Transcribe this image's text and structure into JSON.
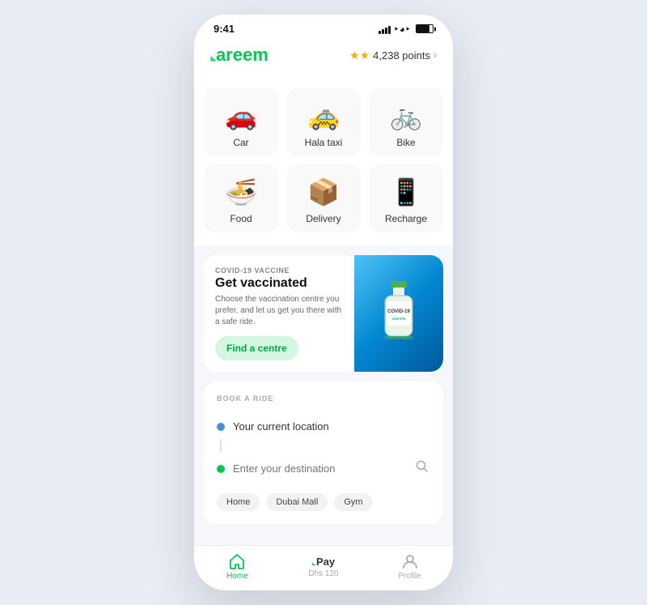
{
  "statusBar": {
    "time": "9:41"
  },
  "header": {
    "logo": "Careem",
    "points": "4,238 points"
  },
  "services": [
    {
      "id": "car",
      "emoji": "🚗",
      "label": "Car"
    },
    {
      "id": "hala-taxi",
      "emoji": "🚕",
      "label": "Hala taxi"
    },
    {
      "id": "bike",
      "emoji": "🚲",
      "label": "Bike"
    },
    {
      "id": "food",
      "emoji": "🍜",
      "label": "Food"
    },
    {
      "id": "delivery",
      "emoji": "📦",
      "label": "Delivery"
    },
    {
      "id": "recharge",
      "emoji": "📱",
      "label": "Recharge"
    }
  ],
  "vaccine": {
    "tag": "COVID-19 VACCINE",
    "title": "Get vaccinated",
    "description": "Choose the vaccination centre you prefer, and let us get you there with a safe ride.",
    "buttonLabel": "Find a centre"
  },
  "bookRide": {
    "sectionLabel": "BOOK A RIDE",
    "currentLocationPlaceholder": "Your current location",
    "destinationPlaceholder": "Enter your destination",
    "quickDestinations": [
      "Home",
      "Dubai Mall",
      "Gym"
    ]
  },
  "bottomNav": [
    {
      "id": "home",
      "icon": "⌂",
      "label": "Home",
      "active": true
    },
    {
      "id": "pay",
      "label": "Pay",
      "sublabel": "Dhs 120",
      "active": false
    },
    {
      "id": "profile",
      "icon": "👤",
      "label": "Profile",
      "active": false
    }
  ]
}
